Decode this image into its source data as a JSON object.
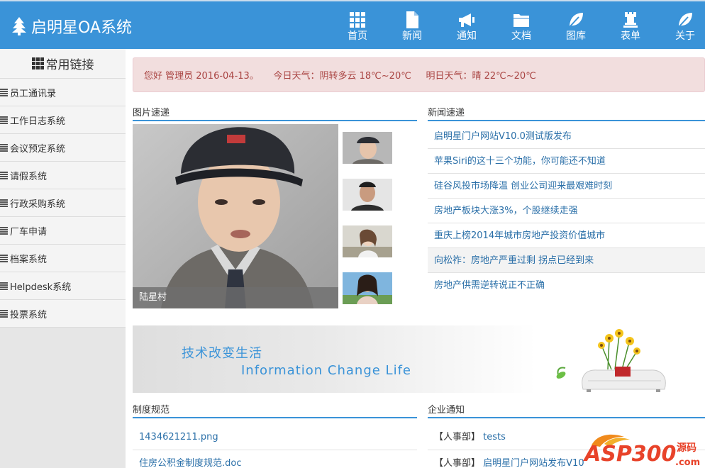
{
  "header": {
    "title": "启明星OA系统",
    "nav": [
      {
        "label": "首页",
        "icon": "grid-icon"
      },
      {
        "label": "新闻",
        "icon": "file-icon"
      },
      {
        "label": "通知",
        "icon": "bullhorn-icon"
      },
      {
        "label": "文档",
        "icon": "folder-icon"
      },
      {
        "label": "图库",
        "icon": "leaf-icon"
      },
      {
        "label": "表单",
        "icon": "rook-icon"
      },
      {
        "label": "关于",
        "icon": "leaf-icon"
      }
    ]
  },
  "sidebar": {
    "title": "常用链接",
    "items": [
      {
        "label": "员工通讯录"
      },
      {
        "label": "工作日志系统"
      },
      {
        "label": "会议预定系统"
      },
      {
        "label": "请假系统"
      },
      {
        "label": "行政采购系统"
      },
      {
        "label": "厂车申请"
      },
      {
        "label": "档案系统"
      },
      {
        "label": "Helpdesk系统"
      },
      {
        "label": "投票系统"
      }
    ]
  },
  "alert": {
    "greeting": "您好 管理员 2016-04-13。",
    "today_weather": "今日天气：阴转多云 18℃~20℃",
    "tomorrow_weather": "明日天气：晴 22℃~20℃"
  },
  "photos": {
    "title": "图片速递",
    "main_caption": "陆星村"
  },
  "news": {
    "title": "新闻速递",
    "items": [
      {
        "text": "启明星门户网站V10.0测试版发布"
      },
      {
        "text": "苹果Siri的这十三个功能，你可能还不知道"
      },
      {
        "text": "硅谷风投市场降温 创业公司迎来最艰难时刻"
      },
      {
        "text": "房地产板块大涨3%，个股继续走强"
      },
      {
        "text": "重庆上榜2014年城市房地产投资价值城市"
      },
      {
        "text": "向松祚：房地产严重过剩 拐点已经到来"
      },
      {
        "text": "房地产供需逆转说正不正确"
      }
    ]
  },
  "banner": {
    "line1": "技术改变生活",
    "line2": "Information Change Life"
  },
  "rules": {
    "title": "制度规范",
    "items": [
      {
        "text": "1434621211.png"
      },
      {
        "text": "住房公积金制度规范.doc"
      }
    ]
  },
  "notices": {
    "title": "企业通知",
    "items": [
      {
        "dept": "【人事部】",
        "text": "tests"
      },
      {
        "dept": "【人事部】",
        "text": "启明星门户网站发布V10"
      }
    ]
  },
  "watermark": {
    "text": "ASP300",
    "sub": "源码",
    "domain": ".com"
  },
  "colors": {
    "brand": "#3a93d8",
    "link": "#2a6fa8",
    "alert_bg": "#f2dede",
    "alert_text": "#a94442"
  }
}
